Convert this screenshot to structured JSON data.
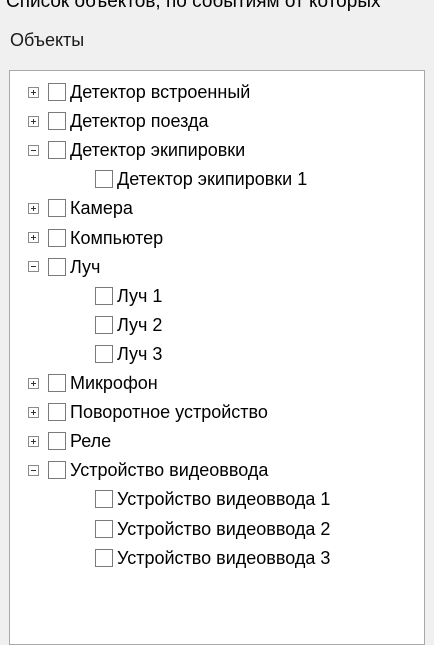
{
  "header_partial_text": "Список объектов, по событиям от которых",
  "group_title": "Объекты",
  "tree": {
    "items": [
      {
        "label": "Детектор встроенный",
        "level": 0,
        "expander": "plus"
      },
      {
        "label": "Детектор поезда",
        "level": 0,
        "expander": "plus"
      },
      {
        "label": "Детектор экипировки",
        "level": 0,
        "expander": "minus"
      },
      {
        "label": "Детектор экипировки 1",
        "level": 1,
        "expander": "none"
      },
      {
        "label": "Камера",
        "level": 0,
        "expander": "plus"
      },
      {
        "label": "Компьютер",
        "level": 0,
        "expander": "plus"
      },
      {
        "label": "Луч",
        "level": 0,
        "expander": "minus"
      },
      {
        "label": "Луч 1",
        "level": 1,
        "expander": "none"
      },
      {
        "label": "Луч 2",
        "level": 1,
        "expander": "none"
      },
      {
        "label": "Луч 3",
        "level": 1,
        "expander": "none"
      },
      {
        "label": "Микрофон",
        "level": 0,
        "expander": "plus"
      },
      {
        "label": "Поворотное устройство",
        "level": 0,
        "expander": "plus"
      },
      {
        "label": "Реле",
        "level": 0,
        "expander": "plus"
      },
      {
        "label": "Устройство видеоввода",
        "level": 0,
        "expander": "minus"
      },
      {
        "label": "Устройство видеоввода 1",
        "level": 1,
        "expander": "none"
      },
      {
        "label": "Устройство видеоввода 2",
        "level": 1,
        "expander": "none"
      },
      {
        "label": "Устройство видеоввода 3",
        "level": 1,
        "expander": "none"
      }
    ]
  }
}
